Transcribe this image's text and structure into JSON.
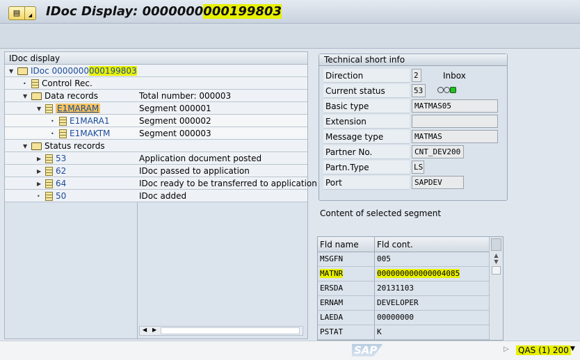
{
  "title": {
    "prefix": "IDoc Display: ",
    "num_a": "0000000",
    "num_b": "000199803"
  },
  "tree": {
    "header": "IDoc display",
    "root_a": "IDoc 0000000",
    "root_b": "000199803",
    "rows": [
      {
        "label": "Control Rec.",
        "desc": ""
      },
      {
        "label": "Data records",
        "desc": "Total number: 000003"
      },
      {
        "label": "E1MARAM",
        "desc": "Segment 000001"
      },
      {
        "label": "E1MARA1",
        "desc": "Segment 000002"
      },
      {
        "label": "E1MAKTM",
        "desc": "Segment 000003"
      },
      {
        "label": "Status records",
        "desc": ""
      },
      {
        "label": "53",
        "desc": "Application document posted"
      },
      {
        "label": "62",
        "desc": "IDoc passed to application"
      },
      {
        "label": "64",
        "desc": "IDoc ready to be transferred to application"
      },
      {
        "label": "50",
        "desc": "IDoc added"
      }
    ]
  },
  "tech": {
    "title": "Technical short info",
    "direction": {
      "label": "Direction",
      "value": "2",
      "text": "Inbox"
    },
    "status": {
      "label": "Current status",
      "value": "53"
    },
    "basic_type": {
      "label": "Basic type",
      "value": "MATMAS05"
    },
    "extension": {
      "label": "Extension",
      "value": ""
    },
    "message_type": {
      "label": "Message type",
      "value": "MATMAS"
    },
    "partner_no": {
      "label": "Partner No.",
      "value": "CNT_DEV200"
    },
    "partner_type": {
      "label": "Partn.Type",
      "value": "LS"
    },
    "port": {
      "label": "Port",
      "value": "SAPDEV"
    }
  },
  "segment": {
    "title": "Content of selected segment",
    "col1": "Fld name",
    "col2": "Fld cont.",
    "rows": [
      [
        "MSGFN",
        "005"
      ],
      [
        "MATNR",
        "000000000000004085"
      ],
      [
        "ERSDA",
        "20131103"
      ],
      [
        "ERNAM",
        "DEVELOPER"
      ],
      [
        "LAEDA",
        "00000000"
      ],
      [
        "PSTAT",
        "K"
      ]
    ]
  },
  "status": {
    "system": "QAS (1) 200",
    "logo": "SAP"
  },
  "colors": {
    "highlight": "#e8f000",
    "status_green": "#22c022"
  }
}
